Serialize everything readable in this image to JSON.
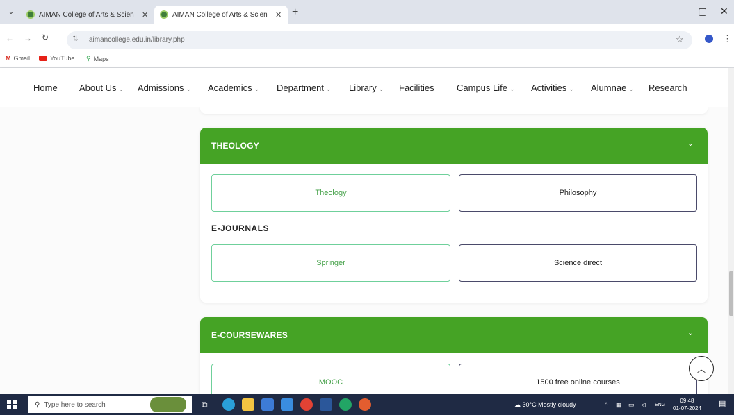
{
  "browser": {
    "tabs": [
      {
        "title": "AIMAN College of Arts & Scien",
        "active": false
      },
      {
        "title": "AIMAN College of Arts & Scien",
        "active": true
      }
    ],
    "new_tab": "+",
    "window_controls": {
      "minimize": "–",
      "maximize": "▢",
      "close": "✕"
    },
    "url": "aimancollege.edu.in/library.php",
    "bookmarks": [
      {
        "label": "Gmail",
        "icon": "gmail-icon"
      },
      {
        "label": "YouTube",
        "icon": "youtube-icon"
      },
      {
        "label": "Maps",
        "icon": "maps-icon"
      }
    ]
  },
  "site_nav": {
    "items": [
      {
        "label": "Home",
        "dropdown": false
      },
      {
        "label": "About Us",
        "dropdown": true
      },
      {
        "label": "Admissions",
        "dropdown": true
      },
      {
        "label": "Academics",
        "dropdown": true
      },
      {
        "label": "Department",
        "dropdown": true
      },
      {
        "label": "Library",
        "dropdown": true
      },
      {
        "label": "Facilities",
        "dropdown": false
      },
      {
        "label": "Campus Life",
        "dropdown": true
      },
      {
        "label": "Activities",
        "dropdown": true
      },
      {
        "label": "Alumnae",
        "dropdown": true
      },
      {
        "label": "Research",
        "dropdown": false
      }
    ],
    "caret": "⌄"
  },
  "sections": {
    "theology": {
      "title": "THEOLOGY",
      "links": [
        "Theology",
        "Philosophy"
      ],
      "subheading": "E-JOURNALS",
      "journals": [
        "Springer",
        "Science direct"
      ]
    },
    "ecoursewares": {
      "title": "E-COURSEWARES",
      "links": [
        "MOOC",
        "1500 free online courses"
      ]
    }
  },
  "taskbar": {
    "search_placeholder": "Type here to search",
    "weather": "30°C  Mostly cloudy",
    "language": "ENG",
    "time": "09:48",
    "date": "01-07-2024"
  },
  "colors": {
    "accent_green": "#45a325",
    "link_green_border": "#6fd09b",
    "taskbar": "#1f2a44"
  }
}
